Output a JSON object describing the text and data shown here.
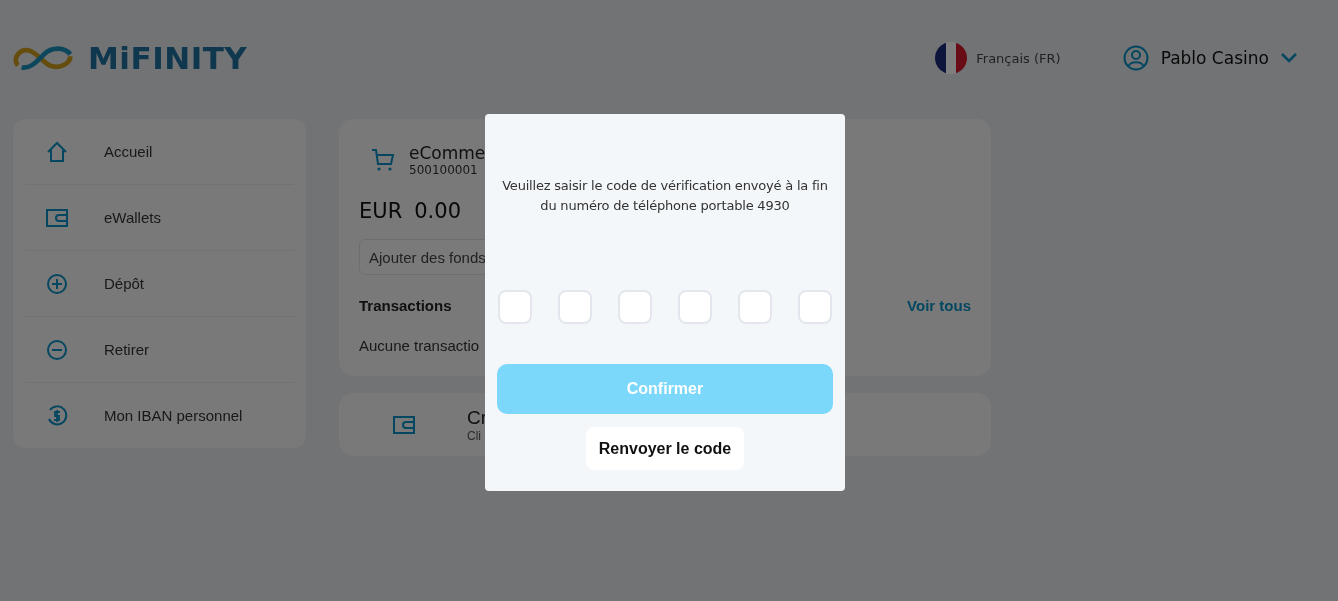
{
  "header": {
    "logo_text": "MiFINITY",
    "language": "Français (FR)",
    "user_name": "Pablo Casino"
  },
  "sidebar": {
    "items": [
      {
        "label": "Accueil"
      },
      {
        "label": "eWallets"
      },
      {
        "label": "Dépôt"
      },
      {
        "label": "Retirer"
      },
      {
        "label": "Mon IBAN personnel"
      }
    ]
  },
  "wallet_card": {
    "name": "eComme",
    "number": "500100001",
    "currency": "EUR",
    "balance": "0.00",
    "add_funds": "Ajouter des fonds",
    "transactions_title": "Transactions",
    "view_all": "Voir tous",
    "empty_text": "Aucune transactio"
  },
  "create_card": {
    "title": "Cr",
    "subtitle": "Cli"
  },
  "modal": {
    "message": "Veuillez saisir le code de vérification envoyé à la fin du numéro de téléphone portable 4930",
    "confirm": {
      "label": "Confirmer",
      "disabled": true
    },
    "resend": "Renvoyer le code"
  }
}
